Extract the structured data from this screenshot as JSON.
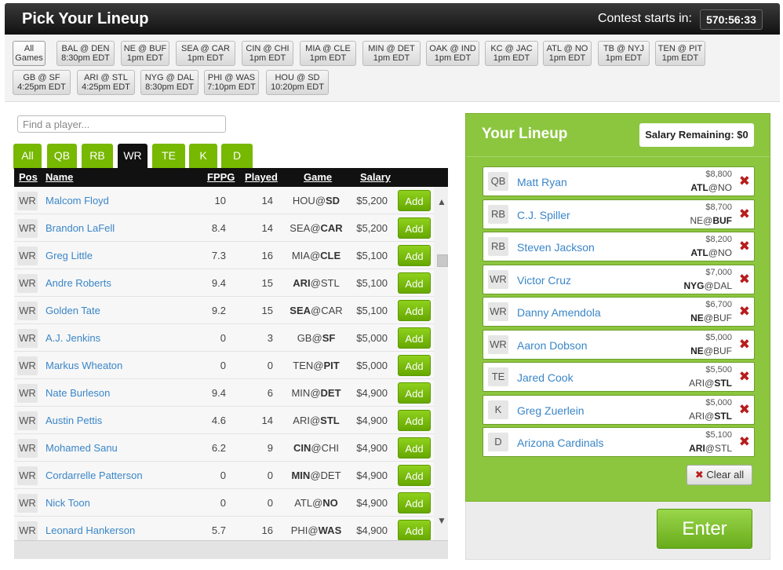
{
  "header": {
    "title": "Pick Your Lineup",
    "contest_label": "Contest starts in:",
    "timer": "570:56:33"
  },
  "games": [
    {
      "line1": "All",
      "line2": "Games",
      "active": true
    },
    {
      "line1": "BAL @ DEN",
      "line2": "8:30pm EDT"
    },
    {
      "line1": "NE @ BUF",
      "line2": "1pm EDT"
    },
    {
      "line1": "SEA @ CAR",
      "line2": "1pm EDT"
    },
    {
      "line1": "CIN @ CHI",
      "line2": "1pm EDT"
    },
    {
      "line1": "MIA @ CLE",
      "line2": "1pm EDT"
    },
    {
      "line1": "MIN @ DET",
      "line2": "1pm EDT"
    },
    {
      "line1": "OAK @ IND",
      "line2": "1pm EDT"
    },
    {
      "line1": "KC @ JAC",
      "line2": "1pm EDT"
    },
    {
      "line1": "ATL @ NO",
      "line2": "1pm EDT"
    },
    {
      "line1": "TB @ NYJ",
      "line2": "1pm EDT"
    },
    {
      "line1": "TEN @ PIT",
      "line2": "1pm EDT"
    },
    {
      "line1": "GB @ SF",
      "line2": "4:25pm EDT"
    },
    {
      "line1": "ARI @ STL",
      "line2": "4:25pm EDT"
    },
    {
      "line1": "NYG @ DAL",
      "line2": "8:30pm EDT"
    },
    {
      "line1": "PHI @ WAS",
      "line2": "7:10pm EDT"
    },
    {
      "line1": "HOU @ SD",
      "line2": "10:20pm EDT"
    }
  ],
  "search": {
    "placeholder": "Find a player...",
    "value": ""
  },
  "tabs": [
    {
      "label": "All"
    },
    {
      "label": "QB"
    },
    {
      "label": "RB"
    },
    {
      "label": "WR",
      "active": true
    },
    {
      "label": "TE"
    },
    {
      "label": "K"
    },
    {
      "label": "D"
    }
  ],
  "columns": {
    "pos": "Pos",
    "name": "Name",
    "fppg": "FPPG",
    "played": "Played",
    "game": "Game",
    "salary": "Salary"
  },
  "add_label": "Add",
  "players": [
    {
      "pos": "WR",
      "name": "Malcom Floyd",
      "fppg": "10",
      "played": "14",
      "away": "HOU",
      "home": "SD",
      "bold": "home",
      "salary": "$5,200"
    },
    {
      "pos": "WR",
      "name": "Brandon LaFell",
      "fppg": "8.4",
      "played": "14",
      "away": "SEA",
      "home": "CAR",
      "bold": "home",
      "salary": "$5,200"
    },
    {
      "pos": "WR",
      "name": "Greg Little",
      "fppg": "7.3",
      "played": "16",
      "away": "MIA",
      "home": "CLE",
      "bold": "home",
      "salary": "$5,100"
    },
    {
      "pos": "WR",
      "name": "Andre Roberts",
      "fppg": "9.4",
      "played": "15",
      "away": "ARI",
      "home": "STL",
      "bold": "away",
      "salary": "$5,100"
    },
    {
      "pos": "WR",
      "name": "Golden Tate",
      "fppg": "9.2",
      "played": "15",
      "away": "SEA",
      "home": "CAR",
      "bold": "away",
      "salary": "$5,100"
    },
    {
      "pos": "WR",
      "name": "A.J. Jenkins",
      "fppg": "0",
      "played": "3",
      "away": "GB",
      "home": "SF",
      "bold": "home",
      "salary": "$5,000"
    },
    {
      "pos": "WR",
      "name": "Markus Wheaton",
      "fppg": "0",
      "played": "0",
      "away": "TEN",
      "home": "PIT",
      "bold": "home",
      "salary": "$5,000"
    },
    {
      "pos": "WR",
      "name": "Nate Burleson",
      "fppg": "9.4",
      "played": "6",
      "away": "MIN",
      "home": "DET",
      "bold": "home",
      "salary": "$4,900"
    },
    {
      "pos": "WR",
      "name": "Austin Pettis",
      "fppg": "4.6",
      "played": "14",
      "away": "ARI",
      "home": "STL",
      "bold": "home",
      "salary": "$4,900"
    },
    {
      "pos": "WR",
      "name": "Mohamed Sanu",
      "fppg": "6.2",
      "played": "9",
      "away": "CIN",
      "home": "CHI",
      "bold": "away",
      "salary": "$4,900"
    },
    {
      "pos": "WR",
      "name": "Cordarrelle Patterson",
      "fppg": "0",
      "played": "0",
      "away": "MIN",
      "home": "DET",
      "bold": "away",
      "salary": "$4,900"
    },
    {
      "pos": "WR",
      "name": "Nick Toon",
      "fppg": "0",
      "played": "0",
      "away": "ATL",
      "home": "NO",
      "bold": "home",
      "salary": "$4,900"
    },
    {
      "pos": "WR",
      "name": "Leonard Hankerson",
      "fppg": "5.7",
      "played": "16",
      "away": "PHI",
      "home": "WAS",
      "bold": "home",
      "salary": "$4,900"
    }
  ],
  "lineup": {
    "title": "Your Lineup",
    "salary_remaining_label": "Salary Remaining:",
    "salary_remaining": "$0",
    "clear_label": "Clear all",
    "enter_label": "Enter",
    "slots": [
      {
        "pos": "QB",
        "name": "Matt Ryan",
        "salary": "$8,800",
        "away": "ATL",
        "home": "NO",
        "bold": "away"
      },
      {
        "pos": "RB",
        "name": "C.J. Spiller",
        "salary": "$8,700",
        "away": "NE",
        "home": "BUF",
        "bold": "home"
      },
      {
        "pos": "RB",
        "name": "Steven Jackson",
        "salary": "$8,200",
        "away": "ATL",
        "home": "NO",
        "bold": "away"
      },
      {
        "pos": "WR",
        "name": "Victor Cruz",
        "salary": "$7,000",
        "away": "NYG",
        "home": "DAL",
        "bold": "away"
      },
      {
        "pos": "WR",
        "name": "Danny Amendola",
        "salary": "$6,700",
        "away": "NE",
        "home": "BUF",
        "bold": "away"
      },
      {
        "pos": "WR",
        "name": "Aaron Dobson",
        "salary": "$5,000",
        "away": "NE",
        "home": "BUF",
        "bold": "away"
      },
      {
        "pos": "TE",
        "name": "Jared Cook",
        "salary": "$5,500",
        "away": "ARI",
        "home": "STL",
        "bold": "home"
      },
      {
        "pos": "K",
        "name": "Greg Zuerlein",
        "salary": "$5,000",
        "away": "ARI",
        "home": "STL",
        "bold": "home"
      },
      {
        "pos": "D",
        "name": "Arizona Cardinals",
        "salary": "$5,100",
        "away": "ARI",
        "home": "STL",
        "bold": "away"
      }
    ]
  },
  "colors": {
    "accent_green": "#8cc63f",
    "button_green": "#77b800",
    "link_blue": "#3a86c8",
    "remove_red": "#b81c1c"
  }
}
